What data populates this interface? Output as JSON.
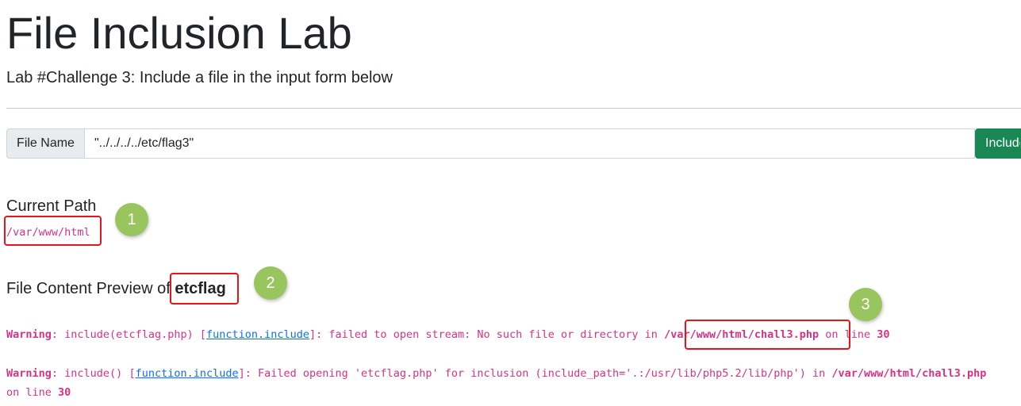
{
  "page": {
    "title": "File Inclusion Lab",
    "subtitle": "Lab #Challenge 3: Include a file in the input form below"
  },
  "form": {
    "label": "File Name",
    "value": "\"../../../../etc/flag3\"",
    "button_label": "Include"
  },
  "current_path": {
    "heading": "Current Path",
    "path": "/var/www/html"
  },
  "preview": {
    "heading_prefix": "File Content Preview of",
    "file_name": "etcflag"
  },
  "warnings": [
    {
      "label": "Warning",
      "before_link": ": include(etcflag.php) [",
      "link": "function.include",
      "after_link": "]: failed to open stream: No such file or directory in ",
      "file": "/var/www/html/chall3.php",
      "line_prefix": " on line ",
      "line": "30"
    },
    {
      "label": "Warning",
      "before_link": ": include() [",
      "link": "function.include",
      "after_link": "]: Failed opening 'etcflag.php' for inclusion (include_path='.:/usr/lib/php5.2/lib/php') in ",
      "file": "/var/www/html/chall3.php",
      "line_prefix": "on line ",
      "line": "30"
    }
  ],
  "annotations": {
    "callouts": [
      "1",
      "2",
      "3"
    ],
    "box_color": "#e8141b",
    "callout_color": "#99c55f"
  },
  "colors": {
    "code": "#d63384",
    "link": "#0d6efd",
    "button": "#198754"
  }
}
